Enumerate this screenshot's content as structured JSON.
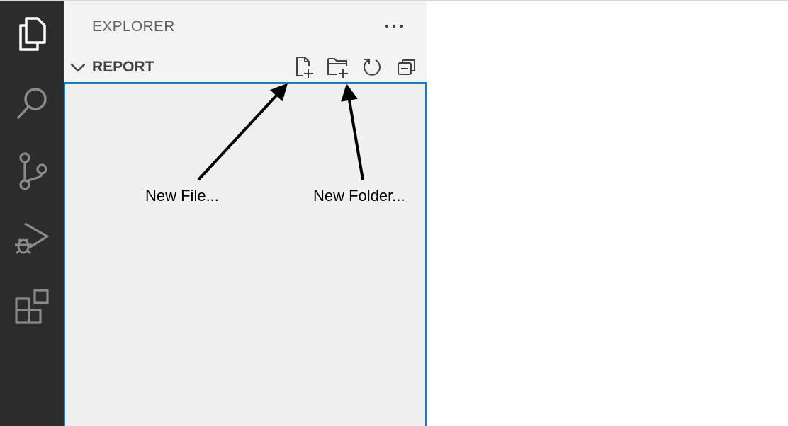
{
  "activity_bar": {
    "items": [
      "explorer",
      "search",
      "source-control",
      "run-and-debug",
      "extensions"
    ],
    "active_item": "explorer"
  },
  "sidebar": {
    "title": "EXPLORER",
    "more_actions_tooltip": "",
    "section": {
      "title": "REPORT",
      "expanded": true,
      "actions": [
        "new-file",
        "new-folder",
        "refresh",
        "collapse-all"
      ]
    }
  },
  "annotations": {
    "new_file_label": "New File...",
    "new_folder_label": "New Folder..."
  },
  "colors": {
    "activity_bar_bg": "#2c2c2c",
    "sidebar_bg": "#f3f3f3",
    "focus_border": "#0a7fd6",
    "icon_inactive": "#8a8a8a",
    "icon_active": "#ffffff"
  }
}
